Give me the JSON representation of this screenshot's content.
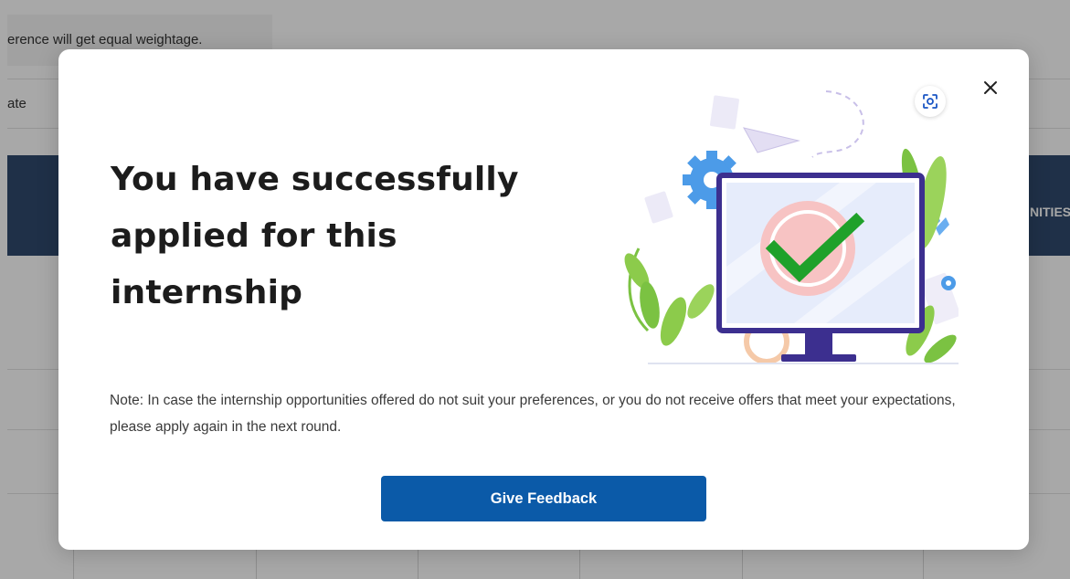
{
  "background": {
    "note_text": "erence will get equal weightage.",
    "column_header_fragment": "ate",
    "table_header_fragment": "NITIES"
  },
  "modal": {
    "title": "You have successfully applied for this internship",
    "note": "Note: In case the internship opportunities offered do not suit your preferences, or you do not receive offers that meet your expectations, please apply again in the next round.",
    "feedback_button_label": "Give Feedback",
    "close_icon": "close-icon",
    "screenshot_icon": "screenshot-icon",
    "illustration": "monitor-with-checkmark-illustration"
  },
  "colors": {
    "primary_button": "#0b5aa8",
    "table_header": "#2f4a6e",
    "check_green": "#1fa12a",
    "monitor_frame": "#3c2f8f"
  }
}
